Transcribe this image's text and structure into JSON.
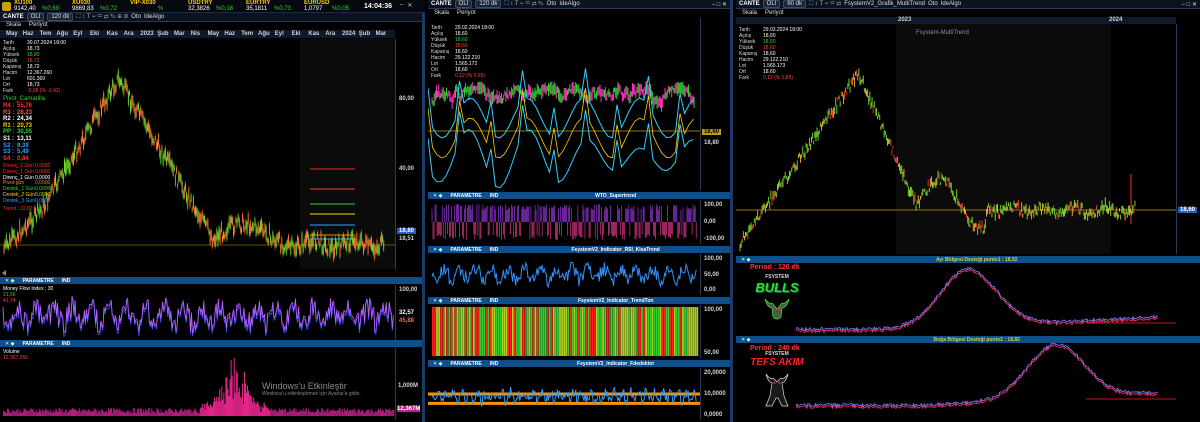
{
  "ticker": [
    {
      "sym": "XU100",
      "val": "9142,40",
      "chg": "%0,69"
    },
    {
      "sym": "XU030",
      "val": "9869,83",
      "chg": "%0,72"
    },
    {
      "sym": "VIP-X030",
      "val": "",
      "chg": "%"
    },
    {
      "sym": "USDTRY",
      "val": "32,3826",
      "chg": "%0,18"
    },
    {
      "sym": "EURTRY",
      "val": "35,1811",
      "chg": "%0,73"
    },
    {
      "sym": "EURUSD",
      "val": "1,0797",
      "chg": "%0,05"
    }
  ],
  "clock": "14:04:36",
  "win_controls": [
    "?",
    "–",
    "□",
    "✕"
  ],
  "left": {
    "toolbar": [
      "CANTE",
      "OLI",
      "120 dk",
      "Oto",
      "IdeAlgo"
    ],
    "menu": [
      "Skala",
      "Periyot"
    ],
    "months": [
      "May",
      "Haz",
      "Tem",
      "Ağu",
      "Eyl",
      "Eki",
      "Kas",
      "Ara",
      "2023",
      "Şub",
      "Mar",
      "Nis",
      "May",
      "Haz",
      "Tem",
      "Ağu",
      "Eyl",
      "Eki",
      "Kas",
      "Ara",
      "2024",
      "Şub",
      "Mar"
    ],
    "ohlc": [
      [
        "Tarih",
        "30.07.2024 18:00"
      ],
      [
        "Açılış",
        "18,73"
      ],
      [
        "Yüksek",
        "18,80"
      ],
      [
        "Düşük",
        "18,72"
      ],
      [
        "Kapanış",
        "18,72"
      ],
      [
        "Hacim",
        "12.367.260"
      ],
      [
        "Lot",
        "601.369"
      ],
      [
        "Ort",
        "18,73"
      ],
      [
        "Fark",
        "-0,08 (% -0,42)"
      ]
    ],
    "pivot_title": "Pivot_Camarilla",
    "pivots": [
      [
        "R4 :",
        "55,76",
        "#ff3030"
      ],
      [
        "R3 :",
        "28,23",
        "#ff5040"
      ],
      [
        "R2 :",
        "24,34",
        "#ffffff"
      ],
      [
        "R1 :",
        "20,73",
        "#ffd000"
      ],
      [
        "PP :",
        "30,05",
        "#30d030"
      ],
      [
        "S1 :",
        "13,11",
        "#ffffff"
      ],
      [
        "S2 :",
        "9,39",
        "#30a0ff"
      ],
      [
        "S3 :",
        "5,49",
        "#30a0ff"
      ],
      [
        "S4 :",
        "0,84",
        "#ff3030"
      ]
    ],
    "levels": [
      [
        "Direnç_2 Gün",
        "0,0000",
        "#ff3030"
      ],
      [
        "Direnç_1 Gün",
        "0,0000",
        "#ff3030"
      ],
      [
        "Direnç_1 Gün",
        "0,0000",
        "#ffffff"
      ],
      [
        "Pivot-gün",
        "0,0000",
        "#ff8800"
      ],
      [
        "Destek_1 Gün",
        "0,0000",
        "#30d030"
      ],
      [
        "Destek_2 Gün",
        "0,0000",
        "#ffd000"
      ],
      [
        "Destek_3 Gün",
        "0,0000",
        "#30a0ff"
      ]
    ],
    "trend_label": "Trend : 22,82",
    "price_ticks": [
      "80,00",
      "40,00",
      "18,80",
      "18,51"
    ],
    "price_tag": "18,80",
    "mfi_header": {
      "p": "PARAMETRE",
      "i": "IND"
    },
    "mfi_label": "Money Flow Index : 30",
    "mfi_vals": [
      "21,56",
      "41,74"
    ],
    "mfi_ticks": [
      "100,00",
      "32,57",
      "45,88"
    ],
    "vol_header": {
      "p": "PARAMETRE",
      "i": "IND"
    },
    "vol_label": "Volume",
    "vol_val": "12.367.260",
    "vol_ticks": [
      "1,000M",
      "12,367M"
    ],
    "watermark1": "Windows'u Etkinleştir",
    "watermark2": "Windows'u etkinleştirmek için Ayarlar'a gidin."
  },
  "mid": {
    "toolbar": [
      "CANTE",
      "OLI",
      "120 dk",
      "Oto",
      "IdeAlgo"
    ],
    "menu": [
      "Skala",
      "Periyot"
    ],
    "ohlc": [
      [
        "Tarih",
        "29.02.2024 18:00"
      ],
      [
        "Açılış",
        "18,60"
      ],
      [
        "Yüksek",
        "18,60"
      ],
      [
        "Düşük",
        "18,60"
      ],
      [
        "Kapanış",
        "18,60"
      ],
      [
        "Hacim",
        "29.122.210"
      ],
      [
        "Lot",
        "1.565.172"
      ],
      [
        "Ort",
        "18,60"
      ],
      [
        "Fark",
        "0,12 (% 0,65)"
      ]
    ],
    "price_ticks": [
      "18,80",
      "18,40"
    ],
    "price_tag": "18,60",
    "panels": [
      {
        "p": "PARAMETRE",
        "i": "IND",
        "title": "WTO_Supertrend",
        "ticks": [
          "100,00",
          "0,00",
          "-100,00"
        ]
      },
      {
        "p": "PARAMETRE",
        "i": "IND",
        "title": "FsystemV2_Indicator_RSI_KisaTrend",
        "ticks": [
          "100,00",
          "50,00",
          "0,00"
        ]
      },
      {
        "p": "PARAMETRE",
        "i": "IND",
        "title": "FsystemV2_Indicator_TrendTon",
        "ticks": [
          "100,00",
          "50,00"
        ]
      },
      {
        "p": "PARAMETRE",
        "i": "IND",
        "title": "FsystemV2_Indicator_Fdedektor",
        "ticks": [
          "20,0000",
          "10,0000",
          "0,0000"
        ]
      }
    ]
  },
  "right": {
    "toolbar": [
      "CANTE",
      "OLI",
      "60 dk",
      "FsystemV2_Grafik_MultiTrend",
      "Oto",
      "IdeAlgo"
    ],
    "menu": [
      "Skala",
      "Periyot"
    ],
    "chart_title": "Fsystem-MultiTrend",
    "years": [
      "2023",
      "2024"
    ],
    "ohlc": [
      [
        "Tarih",
        "29.03.2024 18:00"
      ],
      [
        "Açılış",
        "18,60"
      ],
      [
        "Yüksek",
        "18,60"
      ],
      [
        "Düşük",
        "18,60"
      ],
      [
        "Kapanış",
        "18,60"
      ],
      [
        "Hacim",
        "29.122.210"
      ],
      [
        "Lot",
        "1.565.173"
      ],
      [
        "Ort",
        "18,60"
      ],
      [
        "Fark",
        "0,12 (% 0,65)"
      ]
    ],
    "price_tag": "18,60",
    "p1_header": "Ayı Bölgesi Desteği punto1 : 18,92",
    "p1_period": "Period : 120 dk",
    "logo1_top": "FSYSTEM",
    "logo1_main": "BULLS",
    "p2_header": "Boğa Bölgesi Desteği punto2 : 18,82",
    "p2_period": "Period : 240 dk",
    "logo2_top": "FSYSTEM",
    "logo2_main": "TEFS AKIM"
  }
}
